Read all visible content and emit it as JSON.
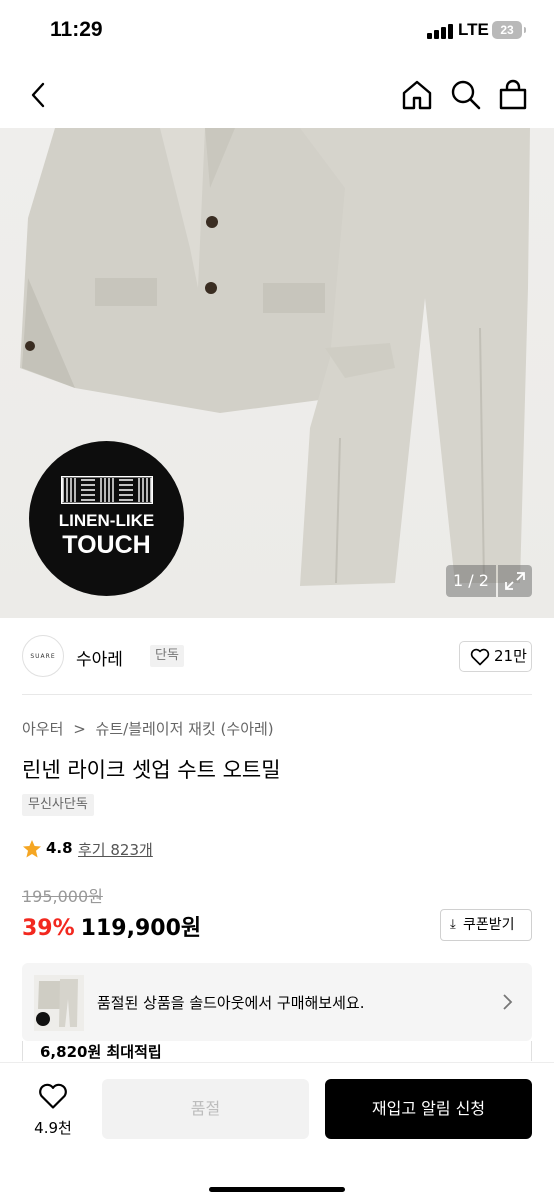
{
  "status_bar": {
    "time": "11:29",
    "network": "LTE",
    "battery": "23"
  },
  "nav": {
    "icons": [
      "back-arrow-icon",
      "home-icon",
      "search-icon",
      "shopping-bag-icon"
    ]
  },
  "image": {
    "badge_line1": "LINEN-LIKE",
    "badge_line2": "TOUCH",
    "counter": "1 / 2"
  },
  "brand": {
    "name": "수아레",
    "logo_text": "SUARE",
    "tag": "단독",
    "likes": "21만"
  },
  "breadcrumb": {
    "category": "아우터",
    "separator": ">",
    "subcategory": "슈트/블레이저 재킷 (수아레)"
  },
  "product": {
    "title": "린넨 라이크 셋업 수트 오트밀",
    "exclusive_tag": "무신사단독",
    "rating": "4.8",
    "reviews": "후기 823개",
    "original_price": "195,000원",
    "discount": "39%",
    "price": "119,900원",
    "coupon_label": "쿠폰받기"
  },
  "soldout_notice": {
    "text": "품절된 상품을 솔드아웃에서 구매해보세요."
  },
  "points": {
    "text": "6,820원 최대적립"
  },
  "bottom_bar": {
    "wish_count": "4.9천",
    "soldout_label": "품절",
    "restock_label": "재입고 알림 신청"
  },
  "colors": {
    "discount": "#f2281f",
    "star": "#f5a623",
    "primary_button": "#000000"
  }
}
